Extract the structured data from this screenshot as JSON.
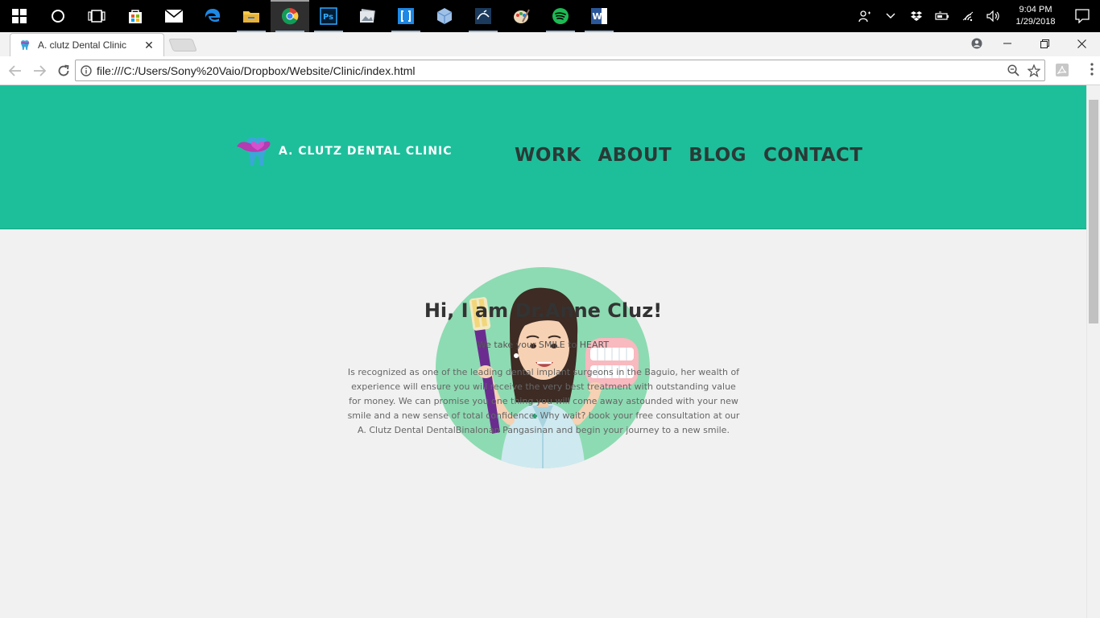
{
  "taskbar": {
    "apps": [
      "start-icon",
      "cortana-icon",
      "task-view-icon",
      "store-icon",
      "mail-icon",
      "edge-icon",
      "file-explorer-icon",
      "chrome-icon",
      "photoshop-icon",
      "photos-icon",
      "bracket-app-icon",
      "box-app-icon",
      "mysql-workbench-icon",
      "paint-icon",
      "spotify-icon",
      "word-icon"
    ],
    "clock_time": "9:04 PM",
    "clock_date": "1/29/2018"
  },
  "browser": {
    "tab_title": "A. clutz Dental Clinic",
    "url": "file:///C:/Users/Sony%20Vaio/Dropbox/Website/Clinic/index.html"
  },
  "site": {
    "brand": "A. CLUTZ DENTAL CLINIC",
    "nav": [
      "WORK",
      "ABOUT",
      "BLOG",
      "CONTACT"
    ],
    "greeting": "Hi, I am Dr.Anne Cluz!",
    "tagline": "We take your SMILE to HEART",
    "bio": "Is recognized as one of the leading dental implant surgeons in the Baguio, her wealth of experience will ensure you will receive the very best treatment with outstanding value for money. We can promise you one thing you will come away astounded with your new smile and a new sense of total confidence. Why wait? book your free consultation at our A. Clutz Dental DentalBinalonan Pangasinan and begin your journey to a new smile."
  },
  "colors": {
    "header": "#1dbf9b",
    "nav_text": "#2a3a36",
    "avatar_bg": "#8ddbb2"
  }
}
